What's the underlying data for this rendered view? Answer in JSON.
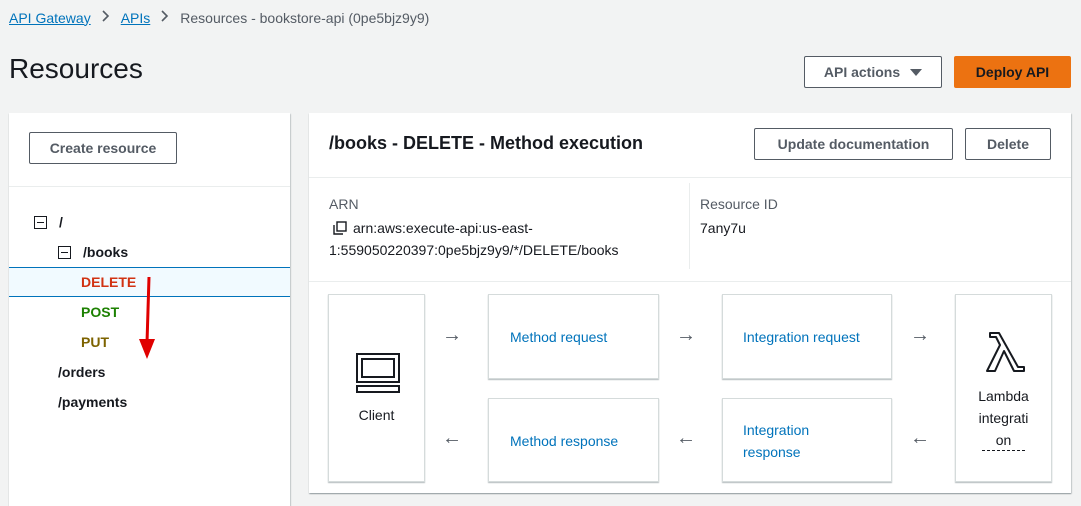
{
  "breadcrumb": {
    "items": [
      "API Gateway",
      "APIs"
    ],
    "current": "Resources - bookstore-api (0pe5bjz9y9)"
  },
  "page": {
    "title": "Resources"
  },
  "header_actions": {
    "api_actions": "API actions",
    "deploy": "Deploy API"
  },
  "left_panel": {
    "create_resource": "Create resource",
    "tree": [
      {
        "label": "/",
        "color": "#16191f"
      },
      {
        "label": "/books",
        "color": "#16191f"
      },
      {
        "label": "DELETE",
        "color": "#d13212"
      },
      {
        "label": "POST",
        "color": "#1d8102"
      },
      {
        "label": "PUT",
        "color": "#7d6300"
      },
      {
        "label": "/orders",
        "color": "#16191f"
      },
      {
        "label": "/payments",
        "color": "#16191f"
      }
    ]
  },
  "right_panel": {
    "title": "/books - DELETE - Method execution",
    "update_documentation": "Update documentation",
    "delete": "Delete",
    "arn_label": "ARN",
    "arn_line1": "arn:aws:execute-api:us-east-",
    "arn_line2": "1:559050220397:0pe5bjz9y9/*/DELETE/books",
    "resource_id_label": "Resource ID",
    "resource_id": "7any7u"
  },
  "flow": {
    "client": "Client",
    "method_request": "Method request",
    "integration_request": "Integration request",
    "method_response": "Method response",
    "integration_response_1": "Integration",
    "integration_response_2": "response",
    "lambda_1": "Lambda",
    "lambda_2": "integrati",
    "lambda_3": "on",
    "right_arrow": "→",
    "left_arrow": "←"
  },
  "colors": {
    "link": "#0073bb",
    "primary": "#ec7211",
    "annotation": "#e00000"
  }
}
